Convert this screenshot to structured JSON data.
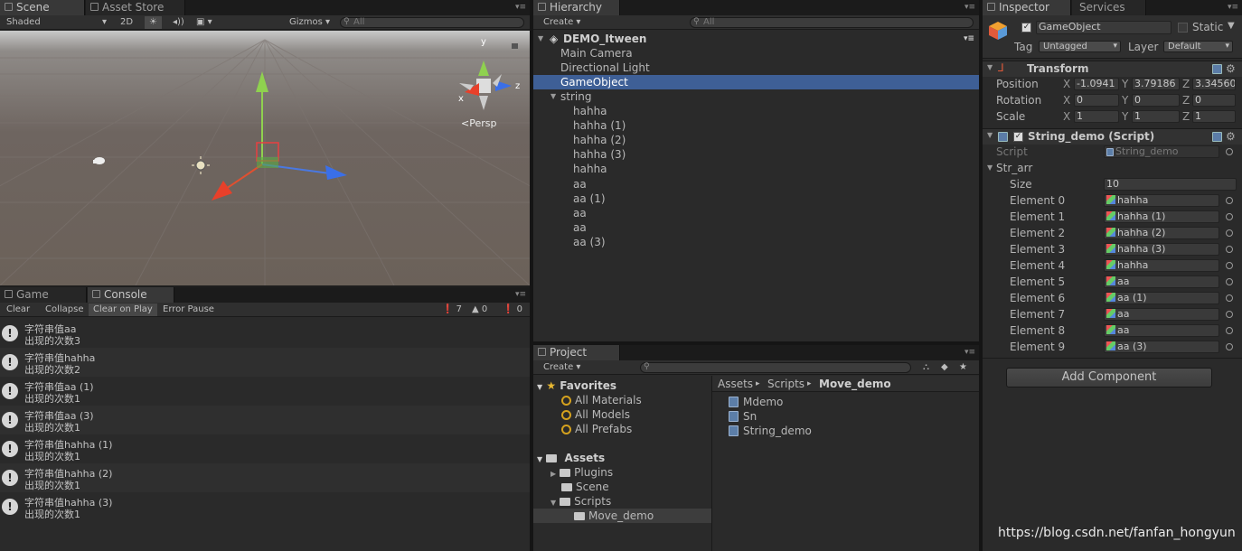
{
  "scene": {
    "tabs": [
      "Scene",
      "Asset Store"
    ],
    "toolbar": {
      "shading": "Shaded",
      "mode2d": "2D",
      "gizmos": "Gizmos",
      "search_placeholder": "All"
    },
    "gizmo_labels": {
      "y": "y",
      "x": "x",
      "z": "z",
      "persp": "Persp"
    }
  },
  "console": {
    "tabs": [
      "Game",
      "Console"
    ],
    "buttons": [
      "Clear",
      "Collapse",
      "Clear on Play",
      "Error Pause"
    ],
    "counts": {
      "info": "7",
      "warn": "0",
      "error": "0"
    },
    "entries": [
      {
        "line1": "字符串值aa",
        "line2": "出现的次数3"
      },
      {
        "line1": "字符串值hahha",
        "line2": "出现的次数2"
      },
      {
        "line1": "字符串值aa (1)",
        "line2": "出现的次数1"
      },
      {
        "line1": "字符串值aa (3)",
        "line2": "出现的次数1"
      },
      {
        "line1": "字符串值hahha (1)",
        "line2": "出现的次数1"
      },
      {
        "line1": "字符串值hahha (2)",
        "line2": "出现的次数1"
      },
      {
        "line1": "字符串值hahha (3)",
        "line2": "出现的次数1"
      }
    ]
  },
  "hierarchy": {
    "tab": "Hierarchy",
    "create": "Create",
    "search_placeholder": "All",
    "scene_name": "DEMO_Itween",
    "items": [
      {
        "label": "Main Camera",
        "indent": 1
      },
      {
        "label": "Directional Light",
        "indent": 1
      },
      {
        "label": "GameObject",
        "indent": 1,
        "selected": true
      },
      {
        "label": "string",
        "indent": 1,
        "expanded": true
      },
      {
        "label": "hahha",
        "indent": 2
      },
      {
        "label": "hahha (1)",
        "indent": 2
      },
      {
        "label": "hahha (2)",
        "indent": 2
      },
      {
        "label": "hahha (3)",
        "indent": 2
      },
      {
        "label": "hahha",
        "indent": 2
      },
      {
        "label": "aa",
        "indent": 2
      },
      {
        "label": "aa (1)",
        "indent": 2
      },
      {
        "label": "aa",
        "indent": 2
      },
      {
        "label": "aa",
        "indent": 2
      },
      {
        "label": "aa (3)",
        "indent": 2
      }
    ]
  },
  "project": {
    "tab": "Project",
    "create": "Create",
    "favorites": {
      "title": "Favorites",
      "items": [
        "All Materials",
        "All Models",
        "All Prefabs"
      ]
    },
    "assets": {
      "title": "Assets",
      "items": [
        "Plugins",
        "Scene",
        "Scripts",
        "Move_demo"
      ]
    },
    "breadcrumb": [
      "Assets",
      "Scripts",
      "Move_demo"
    ],
    "files": [
      "Mdemo",
      "Sn",
      "String_demo"
    ]
  },
  "inspector": {
    "tabs": [
      "Inspector",
      "Services"
    ],
    "object_name": "GameObject",
    "static_label": "Static",
    "tag_label": "Tag",
    "tag_value": "Untagged",
    "layer_label": "Layer",
    "layer_value": "Default",
    "transform": {
      "title": "Transform",
      "position": {
        "label": "Position",
        "x": "-1.0941",
        "y": "3.79186",
        "z": "3.34560"
      },
      "rotation": {
        "label": "Rotation",
        "x": "0",
        "y": "0",
        "z": "0"
      },
      "scale": {
        "label": "Scale",
        "x": "1",
        "y": "1",
        "z": "1"
      }
    },
    "script": {
      "title": "String_demo (Script)",
      "script_label": "Script",
      "script_value": "String_demo",
      "array_label": "Str_arr",
      "size_label": "Size",
      "size_value": "10",
      "elements": [
        {
          "label": "Element 0",
          "value": "hahha"
        },
        {
          "label": "Element 1",
          "value": "hahha (1)"
        },
        {
          "label": "Element 2",
          "value": "hahha (2)"
        },
        {
          "label": "Element 3",
          "value": "hahha (3)"
        },
        {
          "label": "Element 4",
          "value": "hahha"
        },
        {
          "label": "Element 5",
          "value": "aa"
        },
        {
          "label": "Element 6",
          "value": "aa (1)"
        },
        {
          "label": "Element 7",
          "value": "aa"
        },
        {
          "label": "Element 8",
          "value": "aa"
        },
        {
          "label": "Element 9",
          "value": "aa (3)"
        }
      ]
    },
    "add_component": "Add Component"
  },
  "watermark": "https://blog.csdn.net/fanfan_hongyun",
  "colors": {
    "selection": "#3e5f96",
    "panel": "#2a2a2a",
    "toolbar": "#2f2f2f"
  }
}
